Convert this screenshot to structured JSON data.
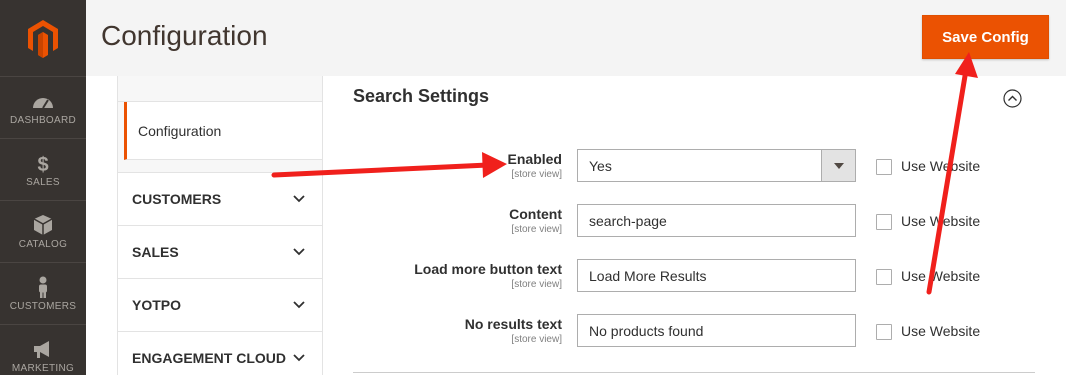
{
  "admin_nav": {
    "items": [
      {
        "label": "DASHBOARD",
        "icon": "dashboard-icon"
      },
      {
        "label": "SALES",
        "icon": "dollar-icon"
      },
      {
        "label": "CATALOG",
        "icon": "box-icon"
      },
      {
        "label": "CUSTOMERS",
        "icon": "person-icon"
      },
      {
        "label": "MARKETING",
        "icon": "megaphone-icon"
      }
    ]
  },
  "header": {
    "title": "Configuration",
    "save_label": "Save Config"
  },
  "tabs": {
    "active": "Configuration",
    "groups": [
      "CUSTOMERS",
      "SALES",
      "YOTPO",
      "ENGAGEMENT CLOUD"
    ]
  },
  "section": {
    "title": "Search Settings",
    "rows": [
      {
        "label": "Enabled",
        "scope": "[store view]",
        "value": "Yes",
        "type": "select",
        "checkbox_label": "Use Website"
      },
      {
        "label": "Content",
        "scope": "[store view]",
        "value": "search-page",
        "type": "text",
        "checkbox_label": "Use Website"
      },
      {
        "label": "Load more button text",
        "scope": "[store view]",
        "value": "Load More Results",
        "type": "text",
        "checkbox_label": "Use Website"
      },
      {
        "label": "No results text",
        "scope": "[store view]",
        "value": "No products found",
        "type": "text",
        "checkbox_label": "Use Website"
      }
    ]
  },
  "colors": {
    "accent": "#eb5202",
    "nav_bg": "#373330",
    "annotation_arrow": "#f0201c"
  }
}
